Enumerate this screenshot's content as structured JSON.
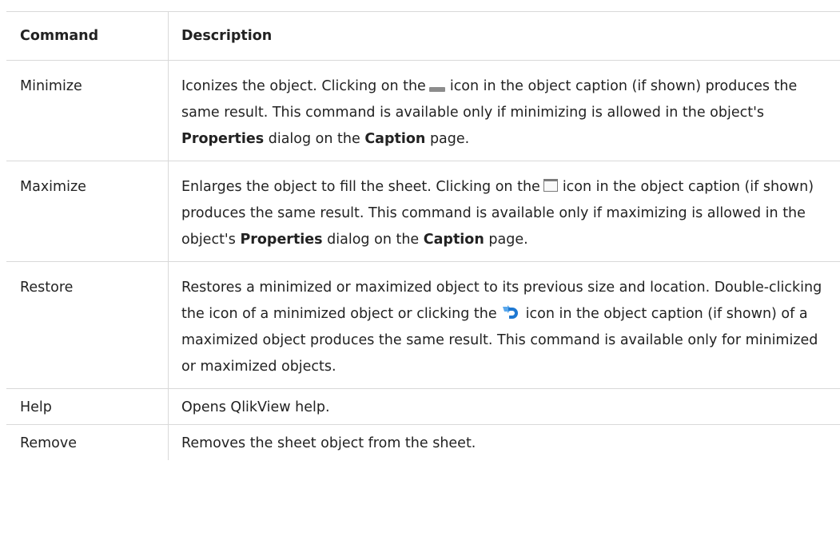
{
  "headers": {
    "command": "Command",
    "description": "Description"
  },
  "rows": [
    {
      "command": "Minimize",
      "desc_a": "Iconizes the object. Clicking on the",
      "icon": "minimize-icon",
      "desc_b": "icon in the object caption (if shown) produces the same result. This command is available only if minimizing is allowed in the object's",
      "bold1": "Properties",
      "desc_c": "dialog on the",
      "bold2": "Caption",
      "desc_d": "page."
    },
    {
      "command": "Maximize",
      "desc_a": "Enlarges the object to fill the sheet. Clicking on the",
      "icon": "maximize-icon",
      "desc_b": "icon in the object caption (if shown) produces the same result. This command is available only if maximizing is allowed in the object's",
      "bold1": "Properties",
      "desc_c": "dialog on the",
      "bold2": "Caption",
      "desc_d": "page."
    },
    {
      "command": "Restore",
      "desc_a": "Restores a minimized or maximized object to its previous size and location. Double-clicking the icon of a minimized object or clicking the",
      "icon": "restore-icon",
      "desc_b": "icon in the object caption (if shown) of a maximized object produces the same result. This command is available only for minimized or maximized objects."
    },
    {
      "command": "Help",
      "desc": "Opens QlikView help."
    },
    {
      "command": "Remove",
      "desc": "Removes the sheet object from the sheet."
    }
  ],
  "colors": {
    "border": "#d9d9d9",
    "text": "#222222",
    "restore_icon": "#1e78d2"
  }
}
